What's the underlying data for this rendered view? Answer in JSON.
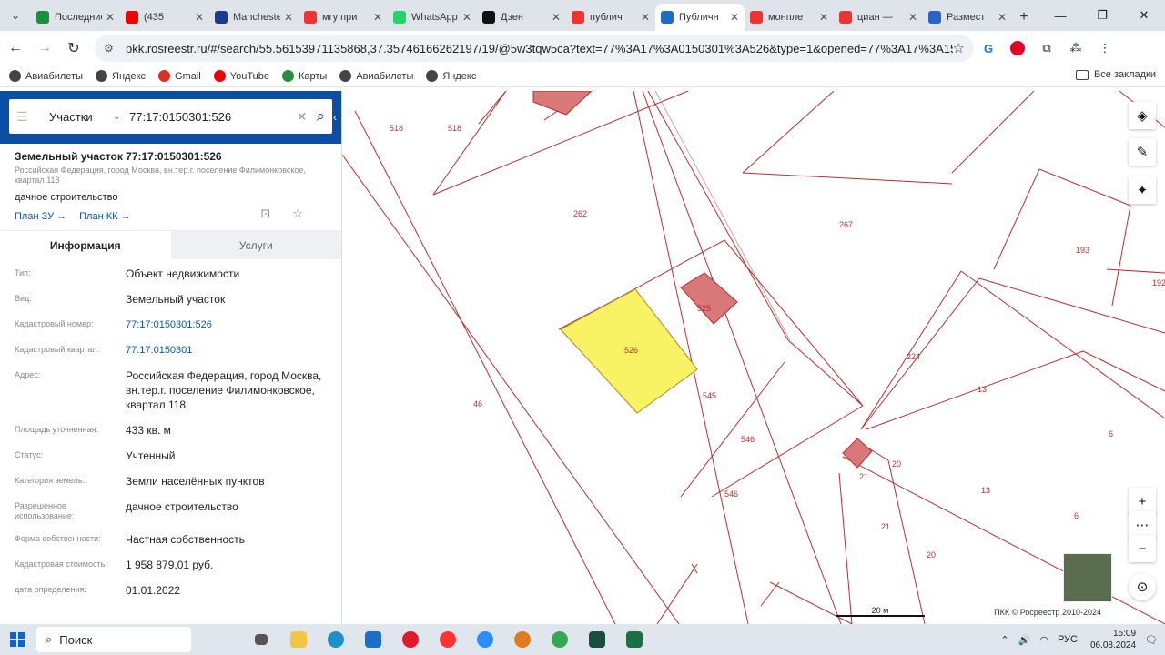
{
  "browser": {
    "tabs": [
      {
        "title": "Последние",
        "color": "#1a8f3c"
      },
      {
        "title": "(435",
        "color": "#e00"
      },
      {
        "title": "Manchester",
        "color": "#1a3c8f"
      },
      {
        "title": "мгу при",
        "color": "#e33"
      },
      {
        "title": "WhatsApp",
        "color": "#25d366"
      },
      {
        "title": "Дзен",
        "color": "#111"
      },
      {
        "title": "публич",
        "color": "#e33"
      },
      {
        "title": "Публичн",
        "color": "#1b6ec2",
        "active": true
      },
      {
        "title": "монпле",
        "color": "#e33"
      },
      {
        "title": "циан —",
        "color": "#e33"
      },
      {
        "title": "Размест",
        "color": "#2a62c9"
      }
    ],
    "url": "pkk.rosreestr.ru/#/search/55.56153971135868,37.35746166262197/19/@5w3tqw5ca?text=77%3A17%3A0150301%3A526&type=1&opened=77%3A17%3A150301%3A526",
    "bookmarks": [
      "Авиабилеты",
      "Яндекс",
      "Gmail",
      "YouTube",
      "Карты",
      "Авиабилеты",
      "Яндекс"
    ],
    "all_bookmarks": "Все закладки"
  },
  "search": {
    "kind": "Участки",
    "query": "77:17:0150301:526"
  },
  "object": {
    "title": "Земельный участок 77:17:0150301:526",
    "address_short": "Российская Федерация, город Москва, вн.тер.г. поселение Филимонковское, квартал 118",
    "use": "дачное строительство",
    "plan_zu": "План ЗУ →",
    "plan_kk": "План КК →"
  },
  "info_tabs": {
    "info": "Информация",
    "services": "Услуги"
  },
  "fields": [
    {
      "k": "Тип:",
      "v": "Объект недвижимости"
    },
    {
      "k": "Вид:",
      "v": "Земельный участок"
    },
    {
      "k": "Кадастровый номер:",
      "v": "77:17:0150301:526",
      "link": true
    },
    {
      "k": "Кадастровый квартал:",
      "v": "77:17:0150301",
      "link": true
    },
    {
      "k": "Адрес:",
      "v": "Российская Федерация, город Москва, вн.тер.г. поселение Филимонковское, квартал 118"
    },
    {
      "k": "Площадь уточненная:",
      "v": "433 кв. м"
    },
    {
      "k": "Статус:",
      "v": "Учтенный"
    },
    {
      "k": "Категория земель:",
      "v": "Земли населённых пунктов"
    },
    {
      "k": "Разрешенное использование:",
      "v": "дачное строительство"
    },
    {
      "k": "Форма собственности:",
      "v": "Частная собственность"
    },
    {
      "k": "Кадастровая стоимость:",
      "v": "1 958 879,01 руб."
    },
    {
      "k": "дата определения:",
      "v": "01.01.2022"
    }
  ],
  "map": {
    "labels": [
      "518",
      "518",
      "262",
      "267",
      "193",
      "192",
      "525",
      "526",
      "545",
      "546",
      "546",
      "46",
      "224",
      "13",
      "13",
      "6",
      "6",
      "20",
      "20",
      "21",
      "21"
    ],
    "scale": "20 м",
    "copyright": "ПКК © Росреестр 2010-2024"
  },
  "taskbar": {
    "search": "Поиск",
    "lang": "РУС",
    "time": "15:09",
    "date": "06.08.2024"
  }
}
